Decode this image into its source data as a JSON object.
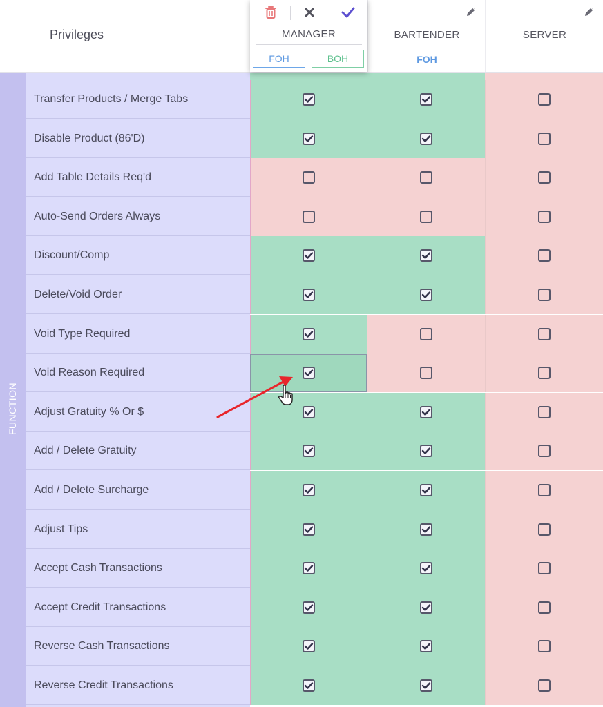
{
  "header": {
    "privileges_label": "Privileges",
    "roles": [
      {
        "name": "MANAGER",
        "tags": [
          "FOH",
          "BOH"
        ],
        "actions": [
          "trash-icon",
          "close-icon",
          "check-icon"
        ]
      },
      {
        "name": "BARTENDER",
        "tag": "FOH",
        "action": "pencil-icon"
      },
      {
        "name": "SERVER",
        "action": "pencil-icon"
      }
    ]
  },
  "section_label": "FUNCTION",
  "rows": [
    {
      "label": "Transfer Products / Merge Tabs",
      "manager": true,
      "bartender": true,
      "server": false
    },
    {
      "label": "Disable Product (86'D)",
      "manager": true,
      "bartender": true,
      "server": false
    },
    {
      "label": "Add Table Details Req'd",
      "manager": false,
      "bartender": false,
      "server": false
    },
    {
      "label": "Auto-Send Orders Always",
      "manager": false,
      "bartender": false,
      "server": false
    },
    {
      "label": "Discount/Comp",
      "manager": true,
      "bartender": true,
      "server": false
    },
    {
      "label": "Delete/Void Order",
      "manager": true,
      "bartender": true,
      "server": false
    },
    {
      "label": "Void Type Required",
      "manager": true,
      "bartender": false,
      "server": false
    },
    {
      "label": "Void Reason Required",
      "manager": true,
      "bartender": false,
      "server": false,
      "highlighted": "manager"
    },
    {
      "label": "Adjust Gratuity % Or $",
      "manager": true,
      "bartender": true,
      "server": false
    },
    {
      "label": "Add / Delete Gratuity",
      "manager": true,
      "bartender": true,
      "server": false
    },
    {
      "label": "Add / Delete Surcharge",
      "manager": true,
      "bartender": true,
      "server": false
    },
    {
      "label": "Adjust Tips",
      "manager": true,
      "bartender": true,
      "server": false
    },
    {
      "label": "Accept Cash Transactions",
      "manager": true,
      "bartender": true,
      "server": false
    },
    {
      "label": "Accept Credit Transactions",
      "manager": true,
      "bartender": true,
      "server": false
    },
    {
      "label": "Reverse Cash Transactions",
      "manager": true,
      "bartender": true,
      "server": false
    },
    {
      "label": "Reverse Credit Transactions",
      "manager": true,
      "bartender": true,
      "server": false
    }
  ],
  "colors": {
    "allowed": "#a8dec5",
    "denied": "#f5d2d2",
    "label_bg": "#dcdcfb",
    "section_strip": "#c3c0ef",
    "foh": "#5e99e1",
    "boh": "#5cc08c",
    "delete": "#e8787a",
    "confirm": "#5c4fd0",
    "annotation_arrow": "#e8262b"
  }
}
